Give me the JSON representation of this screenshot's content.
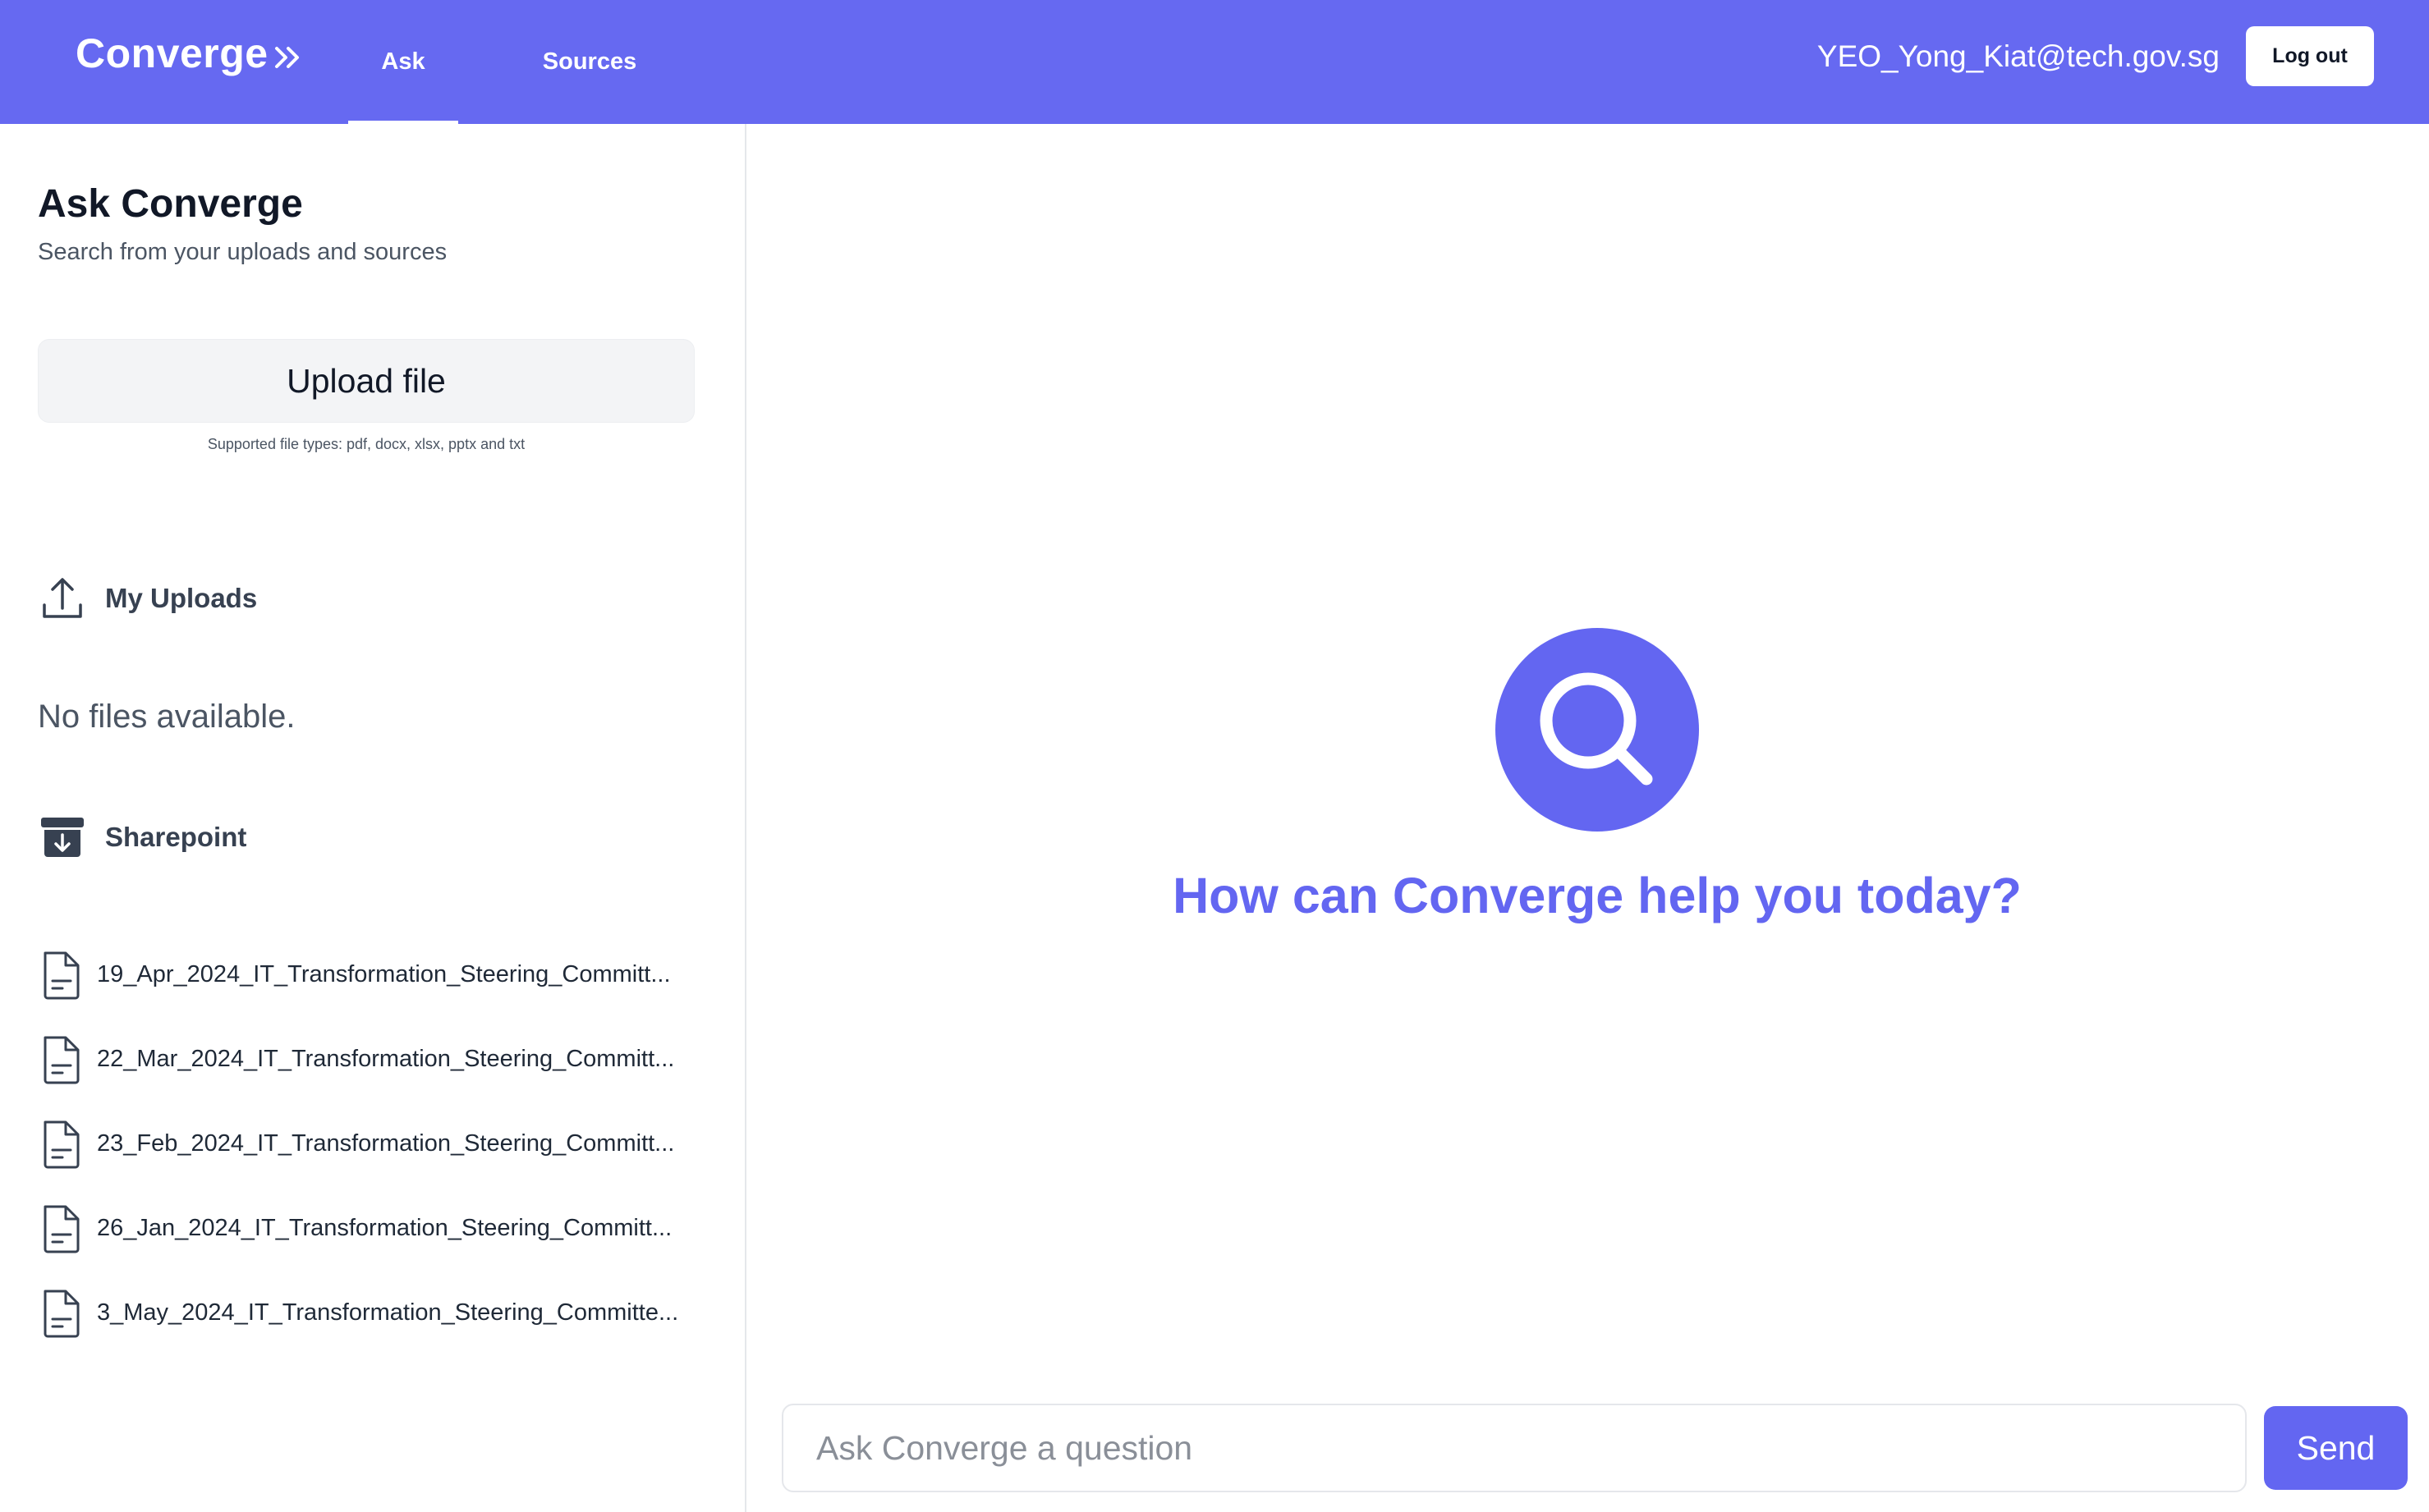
{
  "header": {
    "brand": "Converge",
    "tabs": [
      {
        "label": "Ask"
      },
      {
        "label": "Sources"
      }
    ],
    "user_email": "YEO_Yong_Kiat@tech.gov.sg",
    "logout_label": "Log out",
    "background_color": "#6669f1"
  },
  "sidebar": {
    "title": "Ask Converge",
    "subtitle": "Search from your uploads and sources",
    "upload_label": "Upload file",
    "upload_note": "Supported file types: pdf, docx, xlsx, pptx and txt",
    "uploads": {
      "heading": "My Uploads",
      "icon": "upload-icon",
      "empty_message": "No files available."
    },
    "sharepoint": {
      "heading": "Sharepoint",
      "icon": "archive-download-icon",
      "files": [
        {
          "name": "19_Apr_2024_IT_Transformation_Steering_Committ..."
        },
        {
          "name": "22_Mar_2024_IT_Transformation_Steering_Committ..."
        },
        {
          "name": "23_Feb_2024_IT_Transformation_Steering_Committ..."
        },
        {
          "name": "26_Jan_2024_IT_Transformation_Steering_Committ..."
        },
        {
          "name": "3_May_2024_IT_Transformation_Steering_Committe..."
        }
      ]
    }
  },
  "main": {
    "hero_icon": "search-icon",
    "hero_text": "How can Converge help you today?",
    "input_placeholder": "Ask Converge a question",
    "input_value": "",
    "send_label": "Send",
    "accent_color": "#6366f1"
  }
}
